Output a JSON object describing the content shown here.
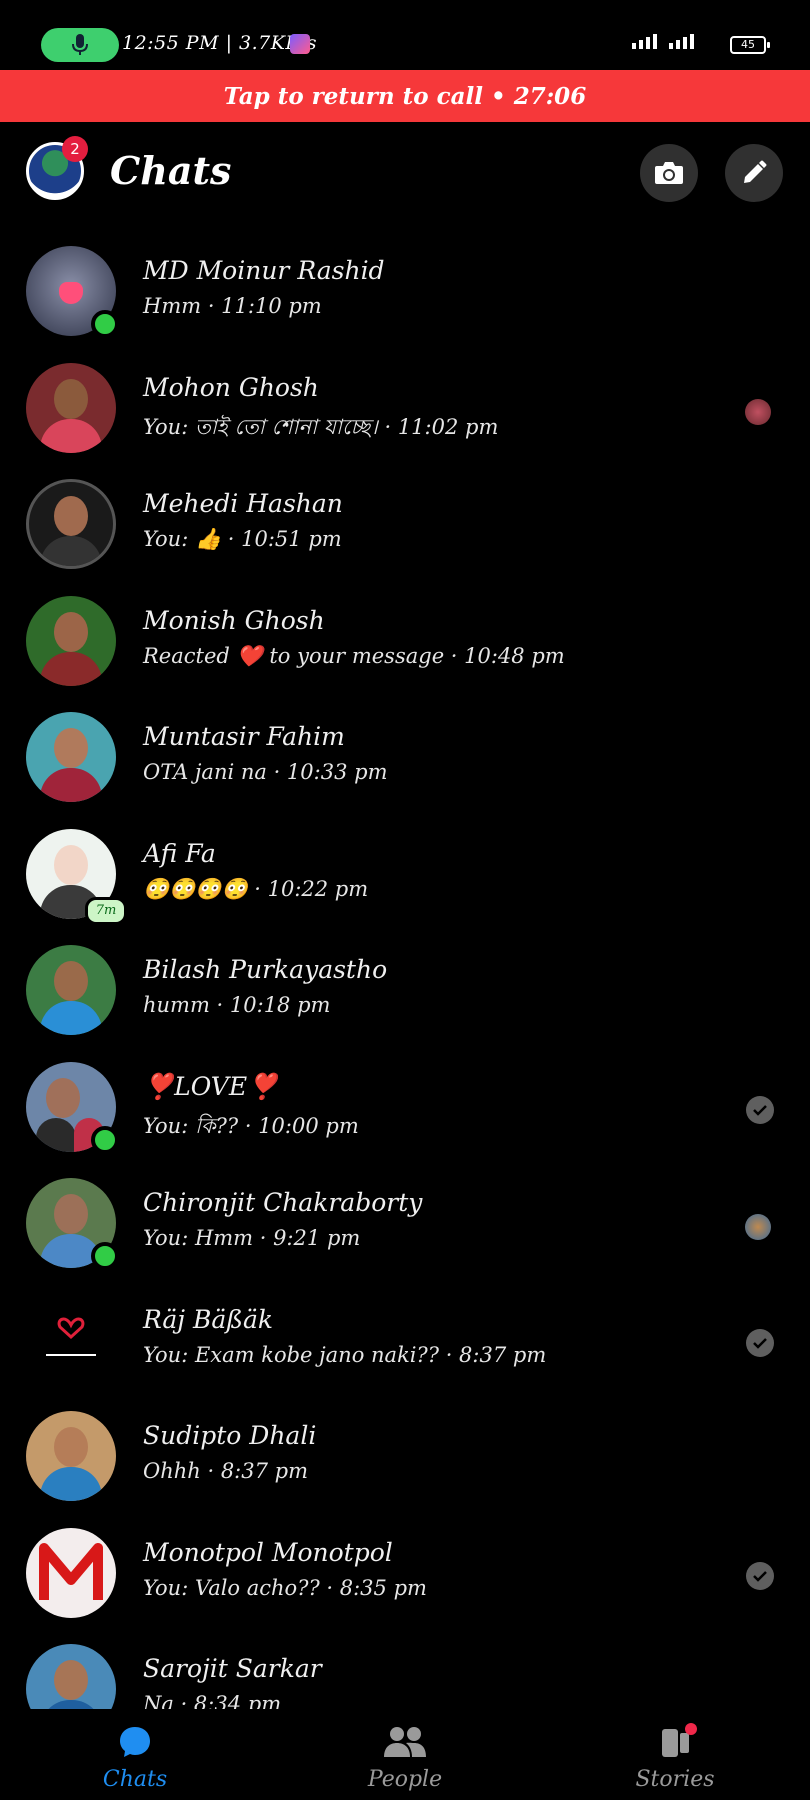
{
  "status_bar": {
    "text": "12:55 PM | 3.7KB/s",
    "battery": "45"
  },
  "call_banner": {
    "text": "Tap to return to call • 27:06"
  },
  "header": {
    "title": "Chats",
    "badge_count": "2"
  },
  "chats": [
    {
      "name": "MD Moinur Rashid",
      "preview": "Hmm · 11:10 pm"
    },
    {
      "name": "Mohon Ghosh",
      "preview": "You: তাই তো শোনা যাচ্ছে। · 11:02 pm"
    },
    {
      "name": "Mehedi Hashan",
      "preview": "You: 👍 · 10:51 pm"
    },
    {
      "name": "Monish Ghosh",
      "preview": "Reacted ❤️ to your message · 10:48 pm"
    },
    {
      "name": "Muntasir Fahim",
      "preview": "OTA jani na · 10:33 pm"
    },
    {
      "name": "Afi Fa",
      "preview": "😳😳😳😳 · 10:22 pm",
      "active_ago": "7m"
    },
    {
      "name": "Bilash Purkayastho",
      "preview": "humm · 10:18 pm"
    },
    {
      "name": "❣️LOVE❣️",
      "preview": "You: কি?? · 10:00 pm"
    },
    {
      "name": "Chironjit Chakraborty",
      "preview": "You: Hmm · 9:21 pm"
    },
    {
      "name": "Räj Bäßäk",
      "preview": "You: Exam kobe jano naki?? · 8:37 pm"
    },
    {
      "name": "Sudipto Dhali",
      "preview": "Ohhh · 8:37 pm"
    },
    {
      "name": "Monotpol Monotpol",
      "preview": "You: Valo acho?? · 8:35 pm"
    },
    {
      "name": "Sarojit Sarkar",
      "preview": "Na · 8:34 pm"
    }
  ],
  "bottom_nav": {
    "chats": "Chats",
    "people": "People",
    "stories": "Stories"
  },
  "colors": {
    "accent": "#1f8ef1",
    "banner": "#f6383a",
    "online": "#31cc46"
  }
}
